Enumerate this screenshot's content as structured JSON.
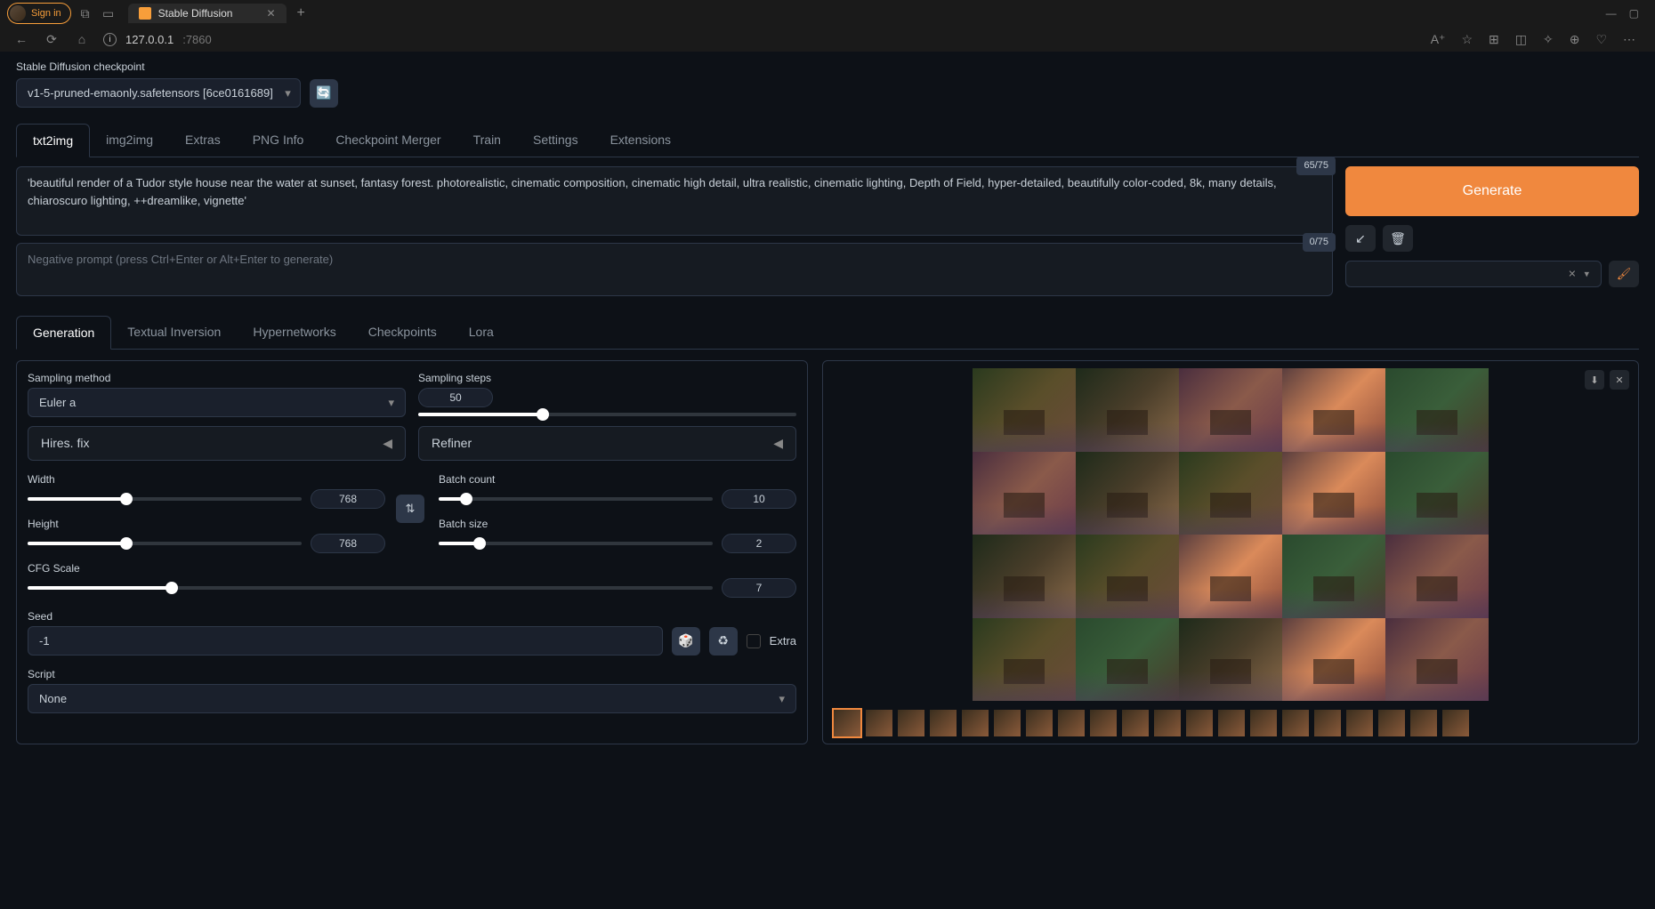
{
  "browser": {
    "signin": "Sign in",
    "tab_title": "Stable Diffusion",
    "url_host": "127.0.0.1",
    "url_port": ":7860"
  },
  "checkpoint": {
    "label": "Stable Diffusion checkpoint",
    "value": "v1-5-pruned-emaonly.safetensors [6ce0161689]"
  },
  "main_tabs": [
    "txt2img",
    "img2img",
    "Extras",
    "PNG Info",
    "Checkpoint Merger",
    "Train",
    "Settings",
    "Extensions"
  ],
  "prompt": {
    "positive": "'beautiful render of a Tudor style house near the water at sunset, fantasy forest. photorealistic, cinematic composition, cinematic high detail, ultra realistic, cinematic lighting, Depth of Field, hyper-detailed, beautifully color-coded, 8k, many details, chiaroscuro lighting, ++dreamlike, vignette'",
    "pos_token": "65/75",
    "negative_placeholder": "Negative prompt (press Ctrl+Enter or Alt+Enter to generate)",
    "neg_token": "0/75"
  },
  "generate": "Generate",
  "sub_tabs": [
    "Generation",
    "Textual Inversion",
    "Hypernetworks",
    "Checkpoints",
    "Lora"
  ],
  "settings": {
    "sampling_method_label": "Sampling method",
    "sampling_method_value": "Euler a",
    "sampling_steps_label": "Sampling steps",
    "sampling_steps_value": "50",
    "hires_label": "Hires. fix",
    "refiner_label": "Refiner",
    "width_label": "Width",
    "width_value": "768",
    "height_label": "Height",
    "height_value": "768",
    "batch_count_label": "Batch count",
    "batch_count_value": "10",
    "batch_size_label": "Batch size",
    "batch_size_value": "2",
    "cfg_label": "CFG Scale",
    "cfg_value": "7",
    "seed_label": "Seed",
    "seed_value": "-1",
    "extra_label": "Extra",
    "script_label": "Script",
    "script_value": "None"
  }
}
